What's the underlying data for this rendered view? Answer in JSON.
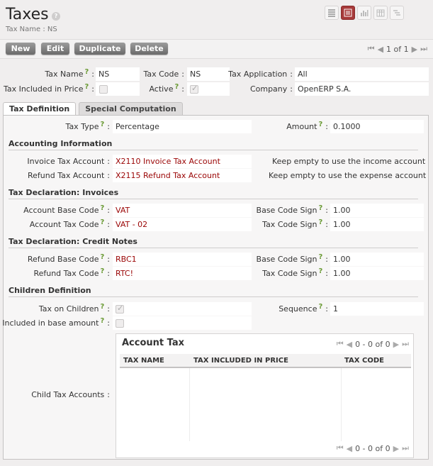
{
  "header": {
    "title": "Taxes",
    "help": "?",
    "subtitle": "Tax Name : NS",
    "views": [
      "list-view-icon",
      "form-view-icon",
      "graph-view-icon",
      "calendar-view-icon",
      "gantt-view-icon"
    ]
  },
  "toolbar": {
    "new_label": "New",
    "edit_label": "Edit",
    "duplicate_label": "Duplicate",
    "delete_label": "Delete",
    "pager": "1 of 1"
  },
  "form": {
    "tax_name": {
      "label": "Tax Name",
      "value": "NS"
    },
    "tax_code": {
      "label": "Tax Code",
      "value": "NS"
    },
    "tax_application": {
      "label": "Tax Application",
      "value": "All"
    },
    "tax_included": {
      "label": "Tax Included in Price",
      "checked": false
    },
    "active": {
      "label": "Active",
      "checked": true
    },
    "company": {
      "label": "Company",
      "value": "OpenERP S.A."
    }
  },
  "tabs": [
    {
      "label": "Tax Definition",
      "active": true
    },
    {
      "label": "Special Computation",
      "active": false
    }
  ],
  "definition": {
    "tax_type": {
      "label": "Tax Type",
      "value": "Percentage"
    },
    "amount": {
      "label": "Amount",
      "value": "0.1000"
    },
    "accounting": {
      "title": "Accounting Information",
      "invoice_account": {
        "label": "Invoice Tax Account",
        "value": "X2110 Invoice Tax Account",
        "hint": "Keep empty to use the income account"
      },
      "refund_account": {
        "label": "Refund Tax Account",
        "value": "X2115 Refund Tax Account",
        "hint": "Keep empty to use the expense account"
      }
    },
    "invoices": {
      "title": "Tax Declaration: Invoices",
      "base_code": {
        "label": "Account Base Code",
        "value": "VAT"
      },
      "base_sign": {
        "label": "Base Code Sign",
        "value": "1.00"
      },
      "tax_code": {
        "label": "Account Tax Code",
        "value": "VAT - 02"
      },
      "tax_sign": {
        "label": "Tax Code Sign",
        "value": "1.00"
      }
    },
    "credit_notes": {
      "title": "Tax Declaration: Credit Notes",
      "base_code": {
        "label": "Refund Base Code",
        "value": "RBC1"
      },
      "base_sign": {
        "label": "Base Code Sign",
        "value": "1.00"
      },
      "tax_code": {
        "label": "Refund Tax Code",
        "value": "RTC!"
      },
      "tax_sign": {
        "label": "Tax Code Sign",
        "value": "1.00"
      }
    },
    "children": {
      "title": "Children Definition",
      "tax_on_children": {
        "label": "Tax on Children",
        "checked": true
      },
      "sequence": {
        "label": "Sequence",
        "value": "1"
      },
      "included_in_base": {
        "label": "Included in base amount",
        "checked": false
      },
      "child_accounts": {
        "label": "Child Tax Accounts"
      }
    }
  },
  "subgrid": {
    "title": "Account Tax",
    "pager": "0 - 0 of 0",
    "columns": [
      "TAX NAME",
      "TAX INCLUDED IN PRICE",
      "TAX CODE"
    ]
  },
  "colors": {
    "accent": "#a73a3a",
    "link": "#9a0404",
    "help_mark": "#6a9a34"
  }
}
